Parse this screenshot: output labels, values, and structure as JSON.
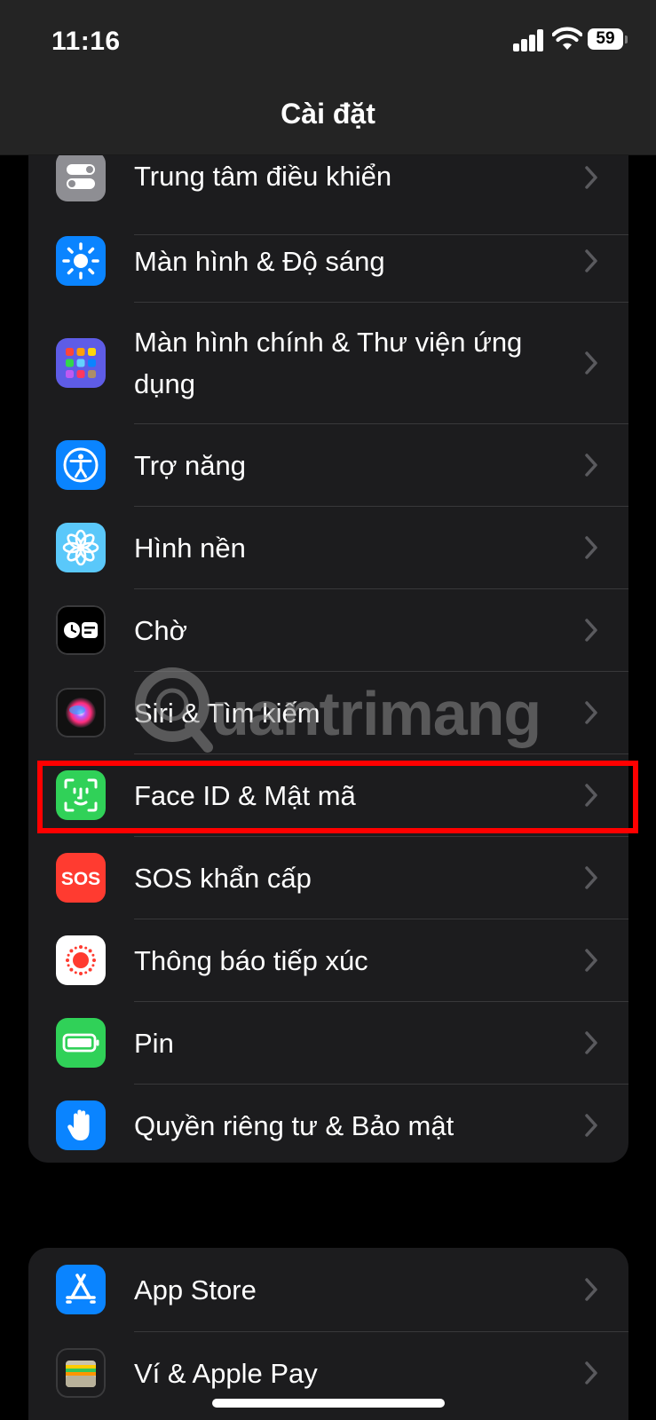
{
  "status": {
    "time": "11:16",
    "battery": "59"
  },
  "nav": {
    "title": "Cài đặt"
  },
  "groups": [
    {
      "items": [
        {
          "label": "Trung tâm điều khiển",
          "icon": "control-center-icon",
          "color": "#8e8e93"
        },
        {
          "label": "Màn hình & Độ sáng",
          "icon": "brightness-icon",
          "color": "#0a84ff"
        },
        {
          "label": "Màn hình chính & Thư viện ứng dụng",
          "icon": "home-screen-icon",
          "color": "#5e5ce6"
        },
        {
          "label": "Trợ năng",
          "icon": "accessibility-icon",
          "color": "#0a84ff"
        },
        {
          "label": "Hình nền",
          "icon": "wallpaper-icon",
          "color": "#5ac8fa"
        },
        {
          "label": "Chờ",
          "icon": "standby-icon",
          "color": "#000000"
        },
        {
          "label": "Siri & Tìm kiếm",
          "icon": "siri-icon",
          "color": "#1c1c1e"
        },
        {
          "label": "Face ID & Mật mã",
          "icon": "face-id-icon",
          "color": "#30d158"
        },
        {
          "label": "SOS khẩn cấp",
          "icon": "sos-icon",
          "color": "#ff3b30"
        },
        {
          "label": "Thông báo tiếp xúc",
          "icon": "exposure-notification-icon",
          "color": "#ffffff"
        },
        {
          "label": "Pin",
          "icon": "battery-icon",
          "color": "#30d158"
        },
        {
          "label": "Quyền riêng tư & Bảo mật",
          "icon": "hand-icon",
          "color": "#0a84ff"
        }
      ]
    },
    {
      "items": [
        {
          "label": "App Store",
          "icon": "app-store-icon",
          "color": "#0a84ff"
        },
        {
          "label": "Ví & Apple Pay",
          "icon": "wallet-icon",
          "color": "#1c1c1e"
        }
      ]
    }
  ],
  "highlight_color": "#ff0000",
  "watermark": "uantrimang"
}
